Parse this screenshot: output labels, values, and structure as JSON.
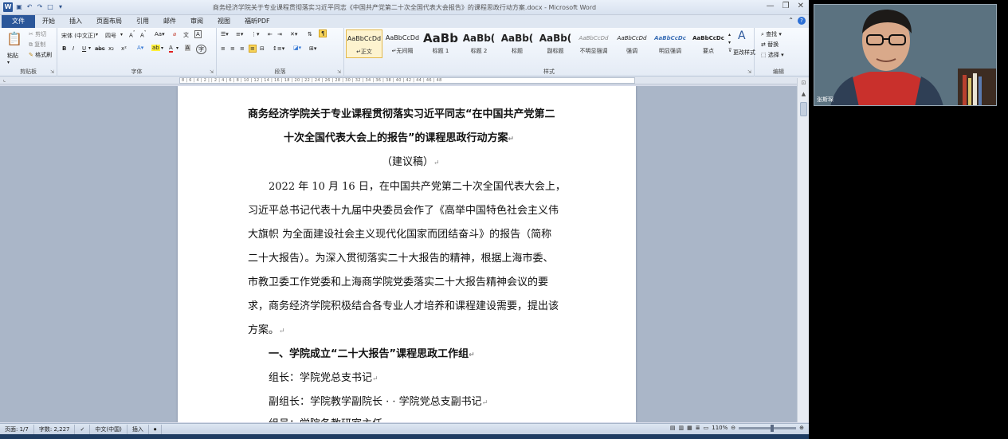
{
  "window": {
    "title": "商务经济学院关于专业课程贯彻落实习近平同志《中国共产党第二十次全国代表大会报告》的课程思政行动方案.docx - Microsoft Word",
    "logo": "W",
    "controls": [
      "—",
      "❐",
      "✕"
    ]
  },
  "qat": [
    "save-icon",
    "undo-icon",
    "redo-icon",
    "new-doc-icon"
  ],
  "tabs": [
    {
      "label": "文件"
    },
    {
      "label": "开始"
    },
    {
      "label": "插入"
    },
    {
      "label": "页面布局"
    },
    {
      "label": "引用"
    },
    {
      "label": "邮件"
    },
    {
      "label": "审阅"
    },
    {
      "label": "视图"
    },
    {
      "label": "福昕PDF"
    }
  ],
  "ribbon": {
    "clipboard": {
      "label": "剪贴板",
      "paste": "粘贴",
      "cut": "剪切",
      "copy": "复制",
      "format_painter": "格式刷"
    },
    "font": {
      "label": "字体",
      "font_name": "宋体 (中文正)",
      "font_size": "四号",
      "row2": [
        "B",
        "I",
        "U",
        "abc",
        "x₂",
        "x²"
      ],
      "font_color": "A"
    },
    "paragraph": {
      "label": "段落"
    },
    "styles": {
      "label": "样式",
      "items": [
        {
          "preview": "AaBbCcDd",
          "name": "↵正文"
        },
        {
          "preview": "AaBbCcDd",
          "name": "↵无间隔"
        },
        {
          "preview": "AaBb",
          "name": "标题 1"
        },
        {
          "preview": "AaBb(",
          "name": "标题 2"
        },
        {
          "preview": "AaBb(",
          "name": "标题"
        },
        {
          "preview": "AaBb(",
          "name": "副标题"
        },
        {
          "preview": "AaBbCcDd",
          "name": "不明显强调"
        },
        {
          "preview": "AaBbCcDd",
          "name": "强调"
        },
        {
          "preview": "AaBbCcDc",
          "name": "明显强调"
        },
        {
          "preview": "AaBbCcDc",
          "name": "要点"
        }
      ],
      "change_styles": "更改样式"
    },
    "editing": {
      "label": "编辑",
      "find": "查找",
      "replace": "替换",
      "select": "选择"
    }
  },
  "ruler": "8 | 6 | 4 | 2 |   | 2 | 4 | 6 | 8 | 10 | 12 | 14 | 16 | 18 | 20 | 22 | 24 | 26 | 28 | 30 | 32 | 34 | 36 | 38 | 40 | 42 | 44 | 46 | 48",
  "document": {
    "title_line1": "商务经济学院关于专业课程贯彻落实习近平同志“在中国共产党第二",
    "title_line2": "十次全国代表大会上的报告”的课程思政行动方案",
    "subtitle": "（建议稿）",
    "para1": [
      "2022 年 10 月 16 日，在中国共产党第二十次全国代表大会上，",
      "习近平总书记代表十九届中央委员会作了《高举中国特色社会主义伟",
      "大旗帜  为全面建设社会主义现代化国家而团结奋斗》的报告（简称",
      "二十大报告）。为深入贯彻落实二十大报告的精神，根据上海市委、",
      "市教卫委工作党委和上海商学院党委落实二十大报告精神会议的要",
      "求，商务经济学院积极结合各专业人才培养和课程建设需要，提出该",
      "方案。"
    ],
    "heading1": "一、学院成立“二十大报告”课程思政工作组",
    "leader": "组长：学院党总支书记",
    "deputy": "副组长：学院教学副院长 · · 学院党总支副书记",
    "member": "组员：学院各教研室主任"
  },
  "status": {
    "page": "页面: 1/7",
    "words": "字数: 2,227",
    "lang": "中文(中国)",
    "mode": "插入",
    "zoom": "110%"
  },
  "camera": {
    "name": "张斯琛"
  }
}
